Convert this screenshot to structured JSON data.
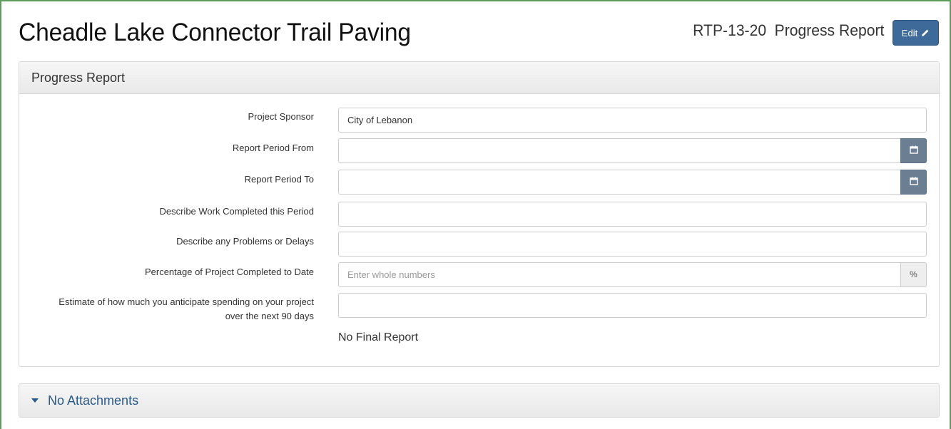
{
  "header": {
    "title": "Cheadle Lake Connector Trail Paving",
    "project_code": "RTP-13-20",
    "report_type": "Progress Report",
    "edit_label": "Edit"
  },
  "panel": {
    "heading": "Progress Report",
    "fields": [
      {
        "label": "Project Sponsor",
        "value": "City of Lebanon",
        "placeholder": ""
      },
      {
        "label": "Report Period From",
        "value": "",
        "placeholder": "",
        "addon_icon": "calendar-icon"
      },
      {
        "label": "Report Period To",
        "value": "",
        "placeholder": "",
        "addon_icon": "calendar-icon"
      },
      {
        "label": "Describe Work Completed this Period",
        "value": "",
        "placeholder": ""
      },
      {
        "label": "Describe any Problems or Delays",
        "value": "",
        "placeholder": ""
      },
      {
        "label": "Percentage of Project Completed to Date",
        "value": "",
        "placeholder": "Enter whole numbers",
        "addon_text": "%"
      },
      {
        "label_line1": "Estimate of how much you anticipate spending on your project",
        "label_line2": "over the next 90 days",
        "value": "",
        "placeholder": ""
      }
    ],
    "final_report_text": "No Final Report"
  },
  "attachments": {
    "label": "No Attachments",
    "toggle_icon": "caret-down-icon"
  },
  "colors": {
    "edit_button": "#3d6a99",
    "calendar_addon": "#6b7e92",
    "attachments_text": "#2a5a8a",
    "frame_border": "#5a9e5a"
  }
}
